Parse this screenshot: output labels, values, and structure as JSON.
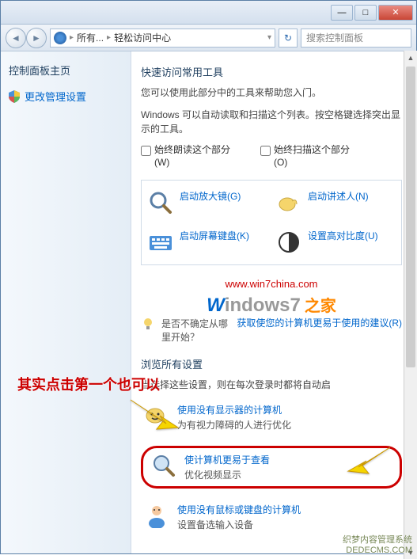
{
  "titlebar": {
    "minimize": "—",
    "maximize": "□",
    "close": "✕"
  },
  "addressbar": {
    "seg1": "所有...",
    "seg2": "轻松访问中心",
    "search_placeholder": "搜索控制面板"
  },
  "sidebar": {
    "title": "控制面板主页",
    "item1": "更改管理设置"
  },
  "quick": {
    "title": "快速访问常用工具",
    "desc1": "您可以使用此部分中的工具来帮助您入门。",
    "desc2": "Windows 可以自动读取和扫描这个列表。按空格键选择突出显示的工具。",
    "check1": "始终朗读这个部分(W)",
    "check2": "始终扫描这个部分(O)"
  },
  "tools": {
    "t1": "启动放大镜(G)",
    "t2": "启动讲述人(N)",
    "t3": "启动屏幕键盘(K)",
    "t4": "设置高对比度(U)"
  },
  "watermark": {
    "url": "www.win7china.com",
    "logo_w": "W",
    "logo_rest": "indows7",
    "logo_zh": " 之家"
  },
  "tip": {
    "text": "是否不确定从哪里开始？",
    "link": "获取使您的计算机更易于使用的建议(R)"
  },
  "browse": {
    "title": "浏览所有设置",
    "desc": "当选择这些设置，则在每次登录时都将自动启",
    "item1_link": "使用没有显示器的计算机",
    "item1_desc": "为有视力障碍的人进行优化",
    "item2_link": "使计算机更易于查看",
    "item2_desc": "优化视频显示",
    "item3_link": "使用没有鼠标或键盘的计算机",
    "item3_desc": "设置备选输入设备"
  },
  "annotation": {
    "text": "其实点击第一个也可以"
  },
  "footer": {
    "line1": "织梦内容管理系统",
    "line2": "DEDECMS.COM"
  }
}
